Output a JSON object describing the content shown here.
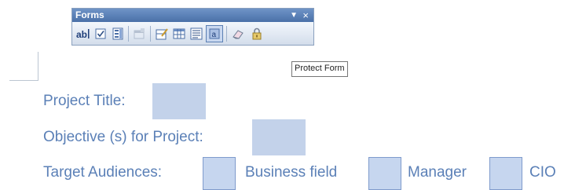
{
  "toolbar": {
    "title": "Forms",
    "dropdown_glyph": "▼",
    "close_glyph": "×",
    "buttons": [
      {
        "name": "text-form-field",
        "icon": "text-field-icon"
      },
      {
        "name": "check-box-form-field",
        "icon": "checkbox-icon"
      },
      {
        "name": "drop-down-form-field",
        "icon": "dropdown-list-icon"
      },
      {
        "name": "form-field-options",
        "icon": "form-field-options-icon",
        "enabled": false
      },
      {
        "name": "draw-table",
        "icon": "draw-table-icon"
      },
      {
        "name": "insert-table",
        "icon": "table-icon"
      },
      {
        "name": "insert-frame",
        "icon": "frame-icon"
      },
      {
        "name": "form-field-shading",
        "icon": "field-shading-icon",
        "pressed": true
      },
      {
        "name": "reset-form-fields",
        "icon": "eraser-icon"
      },
      {
        "name": "protect-form",
        "icon": "lock-icon"
      }
    ]
  },
  "tooltip": {
    "text": "Protect Form"
  },
  "form": {
    "project_title_label": "Project Title:",
    "objective_label": "Objective (s) for Project:",
    "target_audiences_label": "Target Audiences:",
    "option_business_field": "Business field",
    "option_manager": "Manager",
    "option_cio": "CIO"
  },
  "colors": {
    "label_text": "#5b80b7",
    "field_shading": "#c3d2ea",
    "toolbar_title_bg": "#4a70a8"
  }
}
